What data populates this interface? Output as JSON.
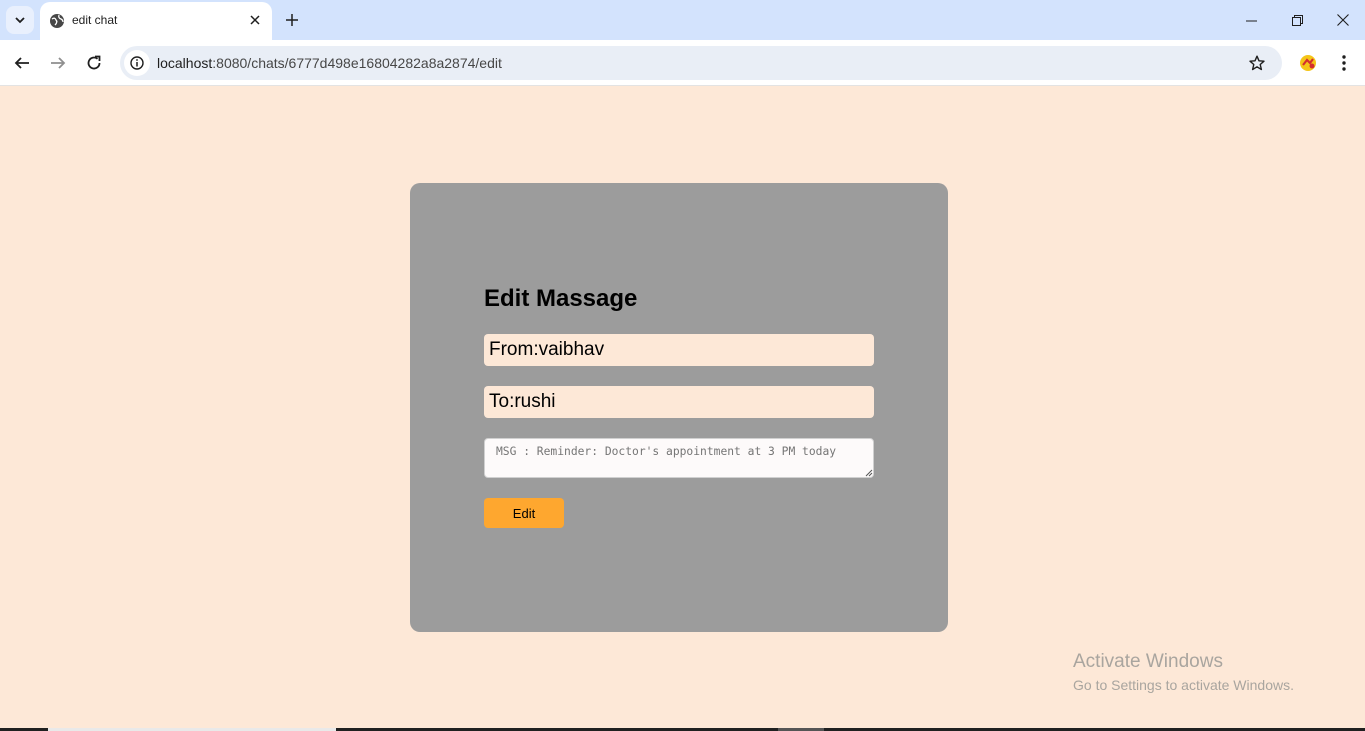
{
  "browser": {
    "tab_title": "edit chat",
    "url_host": "localhost",
    "url_path": ":8080/chats/6777d498e16804282a8a2874/edit",
    "favicon_icon": "globe-icon"
  },
  "form": {
    "heading": "Edit Massage",
    "from_value": "From:vaibhav",
    "to_value": "To:rushi",
    "msg_placeholder": "MSG : Reminder: Doctor's appointment at 3 PM today",
    "submit_label": "Edit"
  },
  "watermark": {
    "title": "Activate Windows",
    "subtitle": "Go to Settings to activate Windows."
  },
  "colors": {
    "page_background": "#fde8d7",
    "card_background": "#9c9c9c",
    "button": "#fea72f",
    "tabbar": "#d3e3fd"
  }
}
